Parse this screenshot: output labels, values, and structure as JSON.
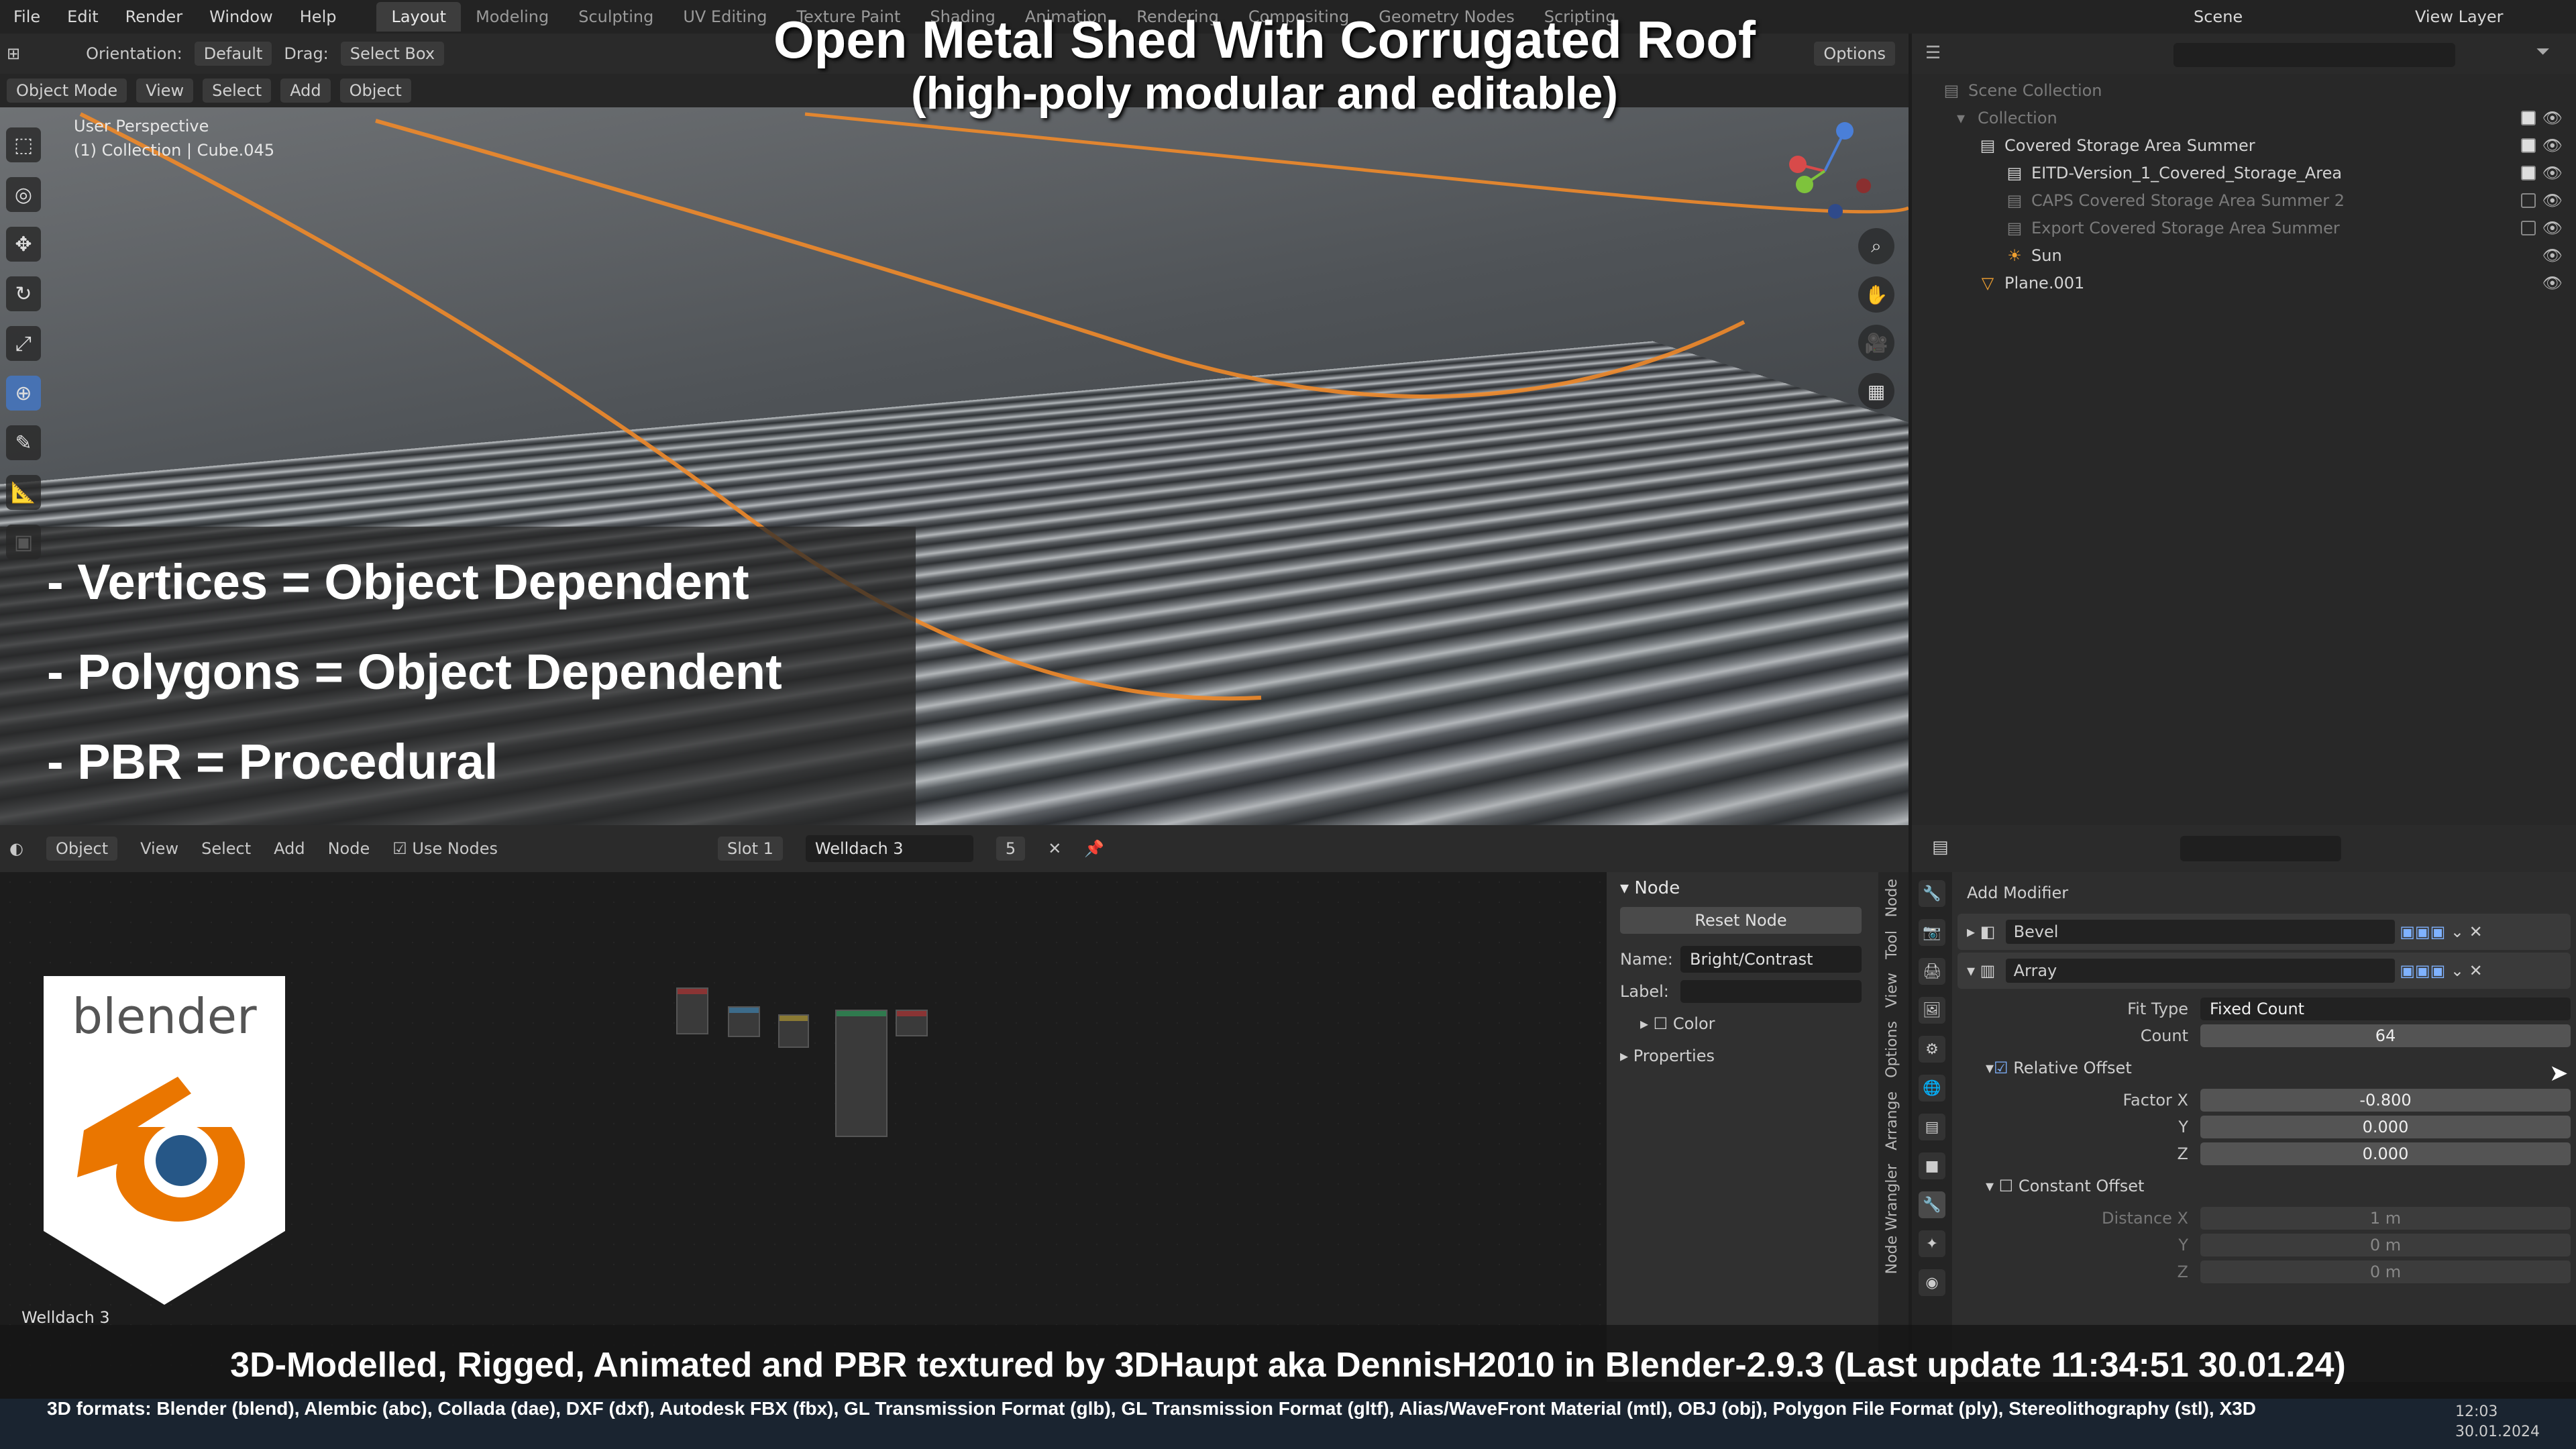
{
  "menubar": {
    "menus": [
      "File",
      "Edit",
      "Render",
      "Window",
      "Help"
    ],
    "workspaces": [
      "Layout",
      "Modeling",
      "Sculpting",
      "UV Editing",
      "Texture Paint",
      "Shading",
      "Animation",
      "Rendering",
      "Compositing",
      "Geometry Nodes",
      "Scripting"
    ],
    "active_workspace": "Layout",
    "scene": "Scene",
    "view_layer": "View Layer"
  },
  "viewport_header": {
    "orientation_label": "Orientation:",
    "orientation": "Default",
    "drag_label": "Drag:",
    "drag": "Select Box",
    "options": "Options",
    "mode": "Object Mode",
    "menus": [
      "View",
      "Select",
      "Add",
      "Object"
    ]
  },
  "viewport": {
    "perspective": "User Perspective",
    "collection": "(1) Collection | Cube.045"
  },
  "overlay": {
    "title": "Open Metal Shed With Corrugated Roof",
    "subtitle": "(high-poly modular and editable)",
    "features": [
      "- Vertices = Object Dependent",
      "- Polygons = Object Dependent",
      "- PBR =  Procedural"
    ],
    "credit": "3D-Modelled, Rigged, Animated and PBR textured by 3DHaupt aka DennisH2010 in Blender-2.9.3 (Last update 11:34:51  30.01.24)",
    "formats": "3D formats: Blender (blend), Alembic (abc), Collada (dae), DXF (dxf), Autodesk FBX (fbx), GL Transmission Format (glb), GL Transmission Format (gltf), Alias/WaveFront Material (mtl), OBJ (obj), Polygon File Format (ply), Stereolithography (stl), X3D",
    "logo_text": "blender"
  },
  "outliner": {
    "rows": [
      {
        "label": "Scene Collection",
        "dim": true
      },
      {
        "label": "Collection",
        "dim": true
      },
      {
        "label": "Covered Storage Area Summer",
        "dim": false
      },
      {
        "label": "EITD-Version_1_Covered_Storage_Area",
        "dim": false
      },
      {
        "label": "CAPS Covered Storage Area Summer 2",
        "dim": true
      },
      {
        "label": "Export Covered Storage Area Summer",
        "dim": true
      },
      {
        "label": "Sun",
        "dim": false
      },
      {
        "label": "Plane.001",
        "dim": false
      }
    ]
  },
  "node_editor": {
    "header": [
      "Object",
      "View",
      "Select",
      "Add",
      "Node"
    ],
    "use_nodes": "Use Nodes",
    "slot": "Slot 1",
    "material": "Welldach 3",
    "users": "5",
    "footer_name": "Welldach 3"
  },
  "node_panel": {
    "section": "Node",
    "reset": "Reset Node",
    "name_label": "Name:",
    "name_value": "Bright/Contrast",
    "label_label": "Label:",
    "color": "Color",
    "properties": "Properties",
    "tabs": [
      "Node",
      "Tool",
      "View",
      "Options",
      "Arrange",
      "Node Wrangler"
    ]
  },
  "properties": {
    "add_modifier": "Add Modifier",
    "modifiers": [
      "Bevel",
      "Array"
    ],
    "fit_type_label": "Fit Type",
    "fit_type": "Fixed Count",
    "count_label": "Count",
    "count": "64",
    "relative_offset": "Relative Offset",
    "factor_x_label": "Factor X",
    "factor_x": "-0.800",
    "y_label": "Y",
    "y": "0.000",
    "z_label": "Z",
    "z": "0.000",
    "constant_offset": "Constant Offset",
    "distance_x_label": "Distance X",
    "distance_x": "1 m",
    "dy": "0 m",
    "dz": "0 m"
  },
  "taskbar": {
    "time": "12:03",
    "date": "30.01.2024"
  }
}
